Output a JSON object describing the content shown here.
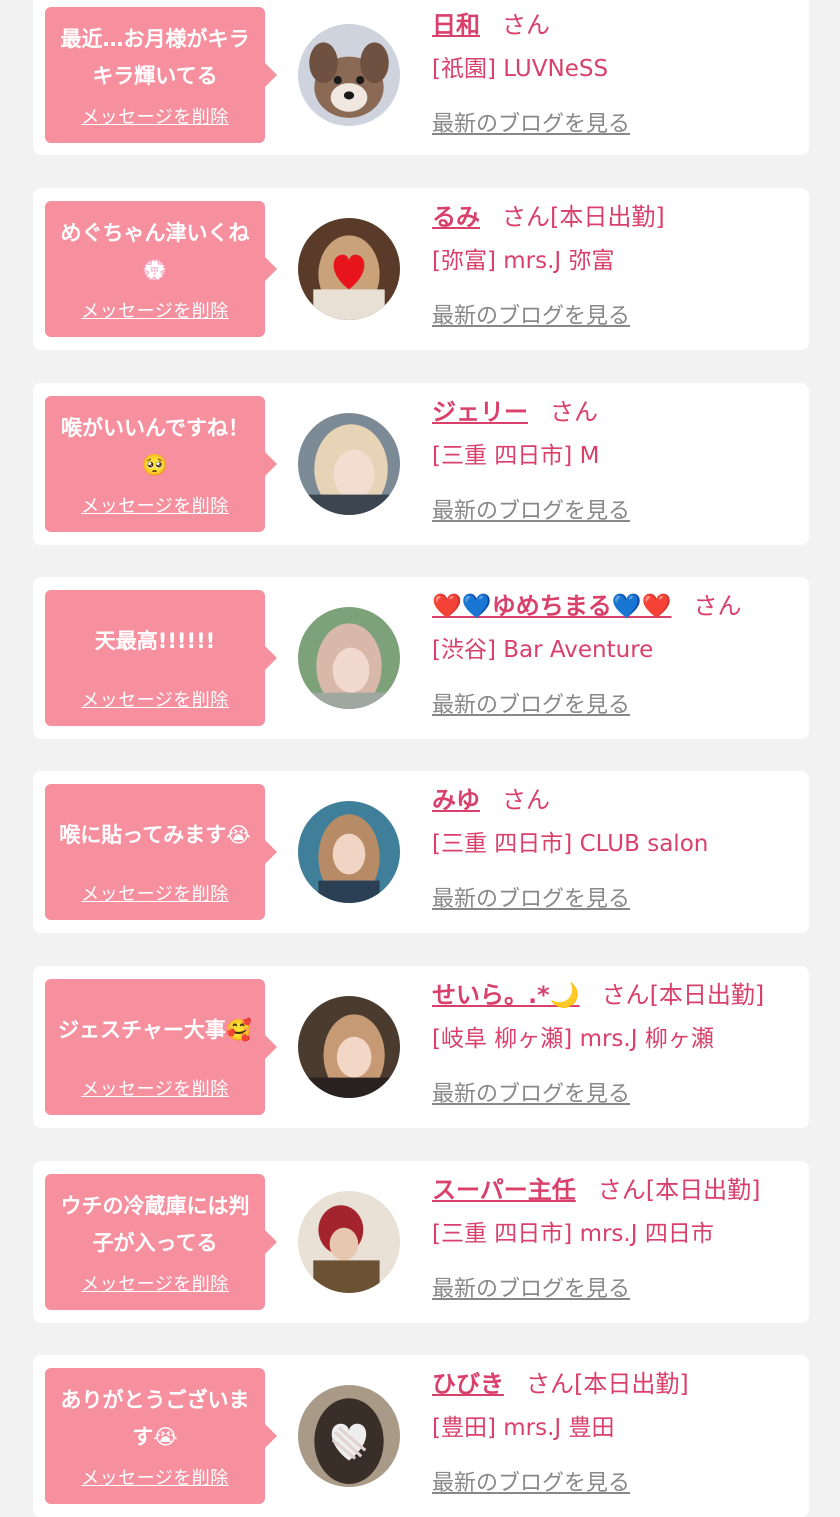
{
  "delete_label": "メッセージを削除",
  "blog_label": "最新のブログを見る",
  "san_label": "さん",
  "items": [
    {
      "message": "最近…お月様がキラキラ輝いてる",
      "name": "日和",
      "suffix": "",
      "shop": "[祇園] LUVNeSS"
    },
    {
      "message": "めぐちゃん津いくね💮",
      "name": "るみ",
      "suffix": "[本日出勤]",
      "shop": "[弥富] mrs.J 弥富"
    },
    {
      "message": "喉がいいんですね！🥺",
      "name": "ジェリー",
      "suffix": "",
      "shop": "[三重 四日市] M"
    },
    {
      "message": "天最高!!!!!!",
      "name": "❤️💙ゆめちまる💙❤️",
      "suffix": "",
      "shop": "[渋谷] Bar Aventure"
    },
    {
      "message": "喉に貼ってみます😭",
      "name": "みゆ",
      "suffix": "",
      "shop": "[三重 四日市] CLUB salon"
    },
    {
      "message": "ジェスチャー大事🥰",
      "name": "せいら。.*🌙",
      "suffix": "[本日出勤]",
      "shop": "[岐阜 柳ヶ瀬] mrs.J 柳ヶ瀬"
    },
    {
      "message": "ウチの冷蔵庫には判子が入ってる",
      "name": "スーパー主任",
      "suffix": "[本日出勤]",
      "shop": "[三重 四日市] mrs.J 四日市"
    },
    {
      "message": "ありがとうございます😭",
      "name": "ひびき",
      "suffix": "[本日出勤]",
      "shop": "[豊田] mrs.J 豊田"
    }
  ],
  "colors": {
    "bubble": "#f6909f",
    "name": "#d9406b",
    "blog_link": "#888888",
    "background": "#f2f2f2"
  }
}
